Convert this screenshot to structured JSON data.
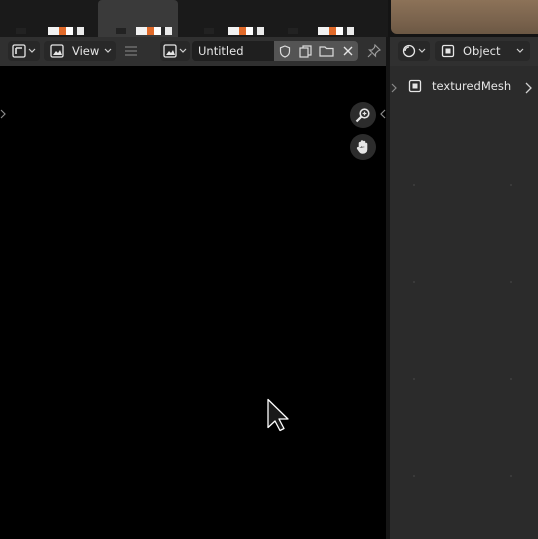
{
  "image_editor": {
    "view_menu": "View",
    "image_name": "Untitled"
  },
  "properties": {
    "mode": "Object",
    "object_name": "texturedMesh"
  },
  "colors": {
    "header_bg": "#303030",
    "canvas_bg": "#000000",
    "panel_bg": "#2b2b2b",
    "field_bg": "#1f1f1f"
  },
  "icons": [
    "editor-type-icon",
    "image-icon",
    "menu-icon",
    "browse-image-icon",
    "fake-user-shield-icon",
    "duplicate-image-icon",
    "open-folder-icon",
    "close-icon",
    "pin-icon",
    "zoom-icon",
    "pan-hand-icon",
    "viewport-shading-icon",
    "object-mode-icon",
    "object-icon",
    "chevron-right-icon",
    "mouse-cursor-icon"
  ]
}
